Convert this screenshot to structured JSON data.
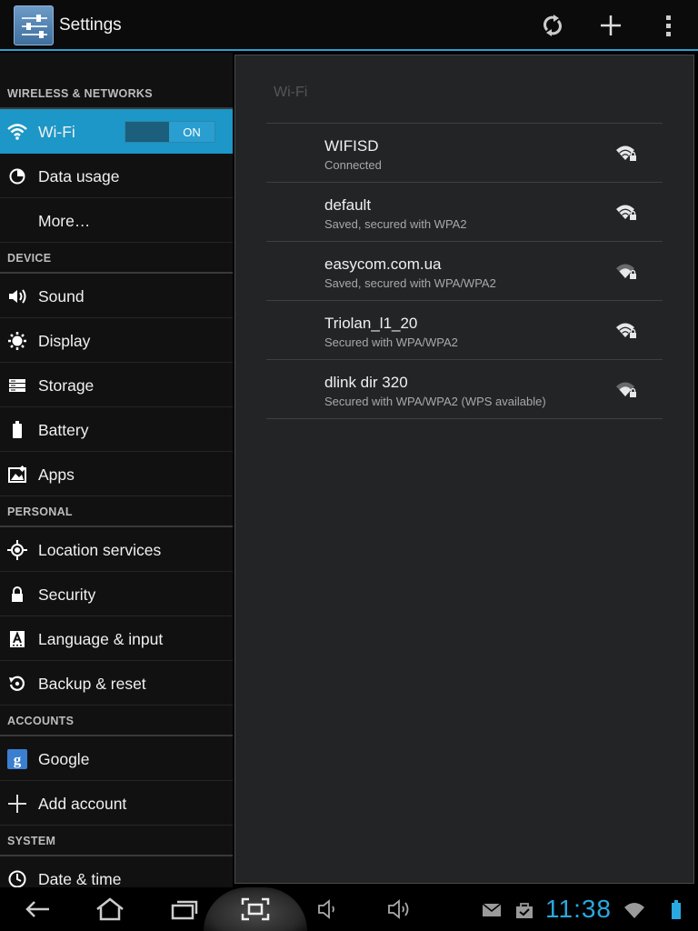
{
  "action_bar": {
    "title": "Settings",
    "actions": [
      {
        "name": "sync-icon"
      },
      {
        "name": "add-network-icon"
      },
      {
        "name": "overflow-menu-icon"
      }
    ]
  },
  "sidebar": {
    "sections": [
      {
        "header": "WIRELESS & NETWORKS",
        "items": [
          {
            "label": "Wi-Fi",
            "icon": "wifi-icon",
            "selected": true,
            "toggle": "ON"
          },
          {
            "label": "Data usage",
            "icon": "data-usage-icon"
          },
          {
            "label": "More…",
            "icon": ""
          }
        ]
      },
      {
        "header": "DEVICE",
        "items": [
          {
            "label": "Sound",
            "icon": "sound-icon"
          },
          {
            "label": "Display",
            "icon": "display-icon"
          },
          {
            "label": "Storage",
            "icon": "storage-icon"
          },
          {
            "label": "Battery",
            "icon": "battery-icon"
          },
          {
            "label": "Apps",
            "icon": "apps-icon"
          }
        ]
      },
      {
        "header": "PERSONAL",
        "items": [
          {
            "label": "Location services",
            "icon": "location-icon"
          },
          {
            "label": "Security",
            "icon": "lock-icon"
          },
          {
            "label": "Language & input",
            "icon": "language-icon"
          },
          {
            "label": "Backup & reset",
            "icon": "backup-icon"
          }
        ]
      },
      {
        "header": "ACCOUNTS",
        "items": [
          {
            "label": "Google",
            "icon": "google-icon"
          },
          {
            "label": "Add account",
            "icon": "add-icon"
          }
        ]
      },
      {
        "header": "SYSTEM",
        "items": [
          {
            "label": "Date & time",
            "icon": "clock-icon"
          }
        ]
      }
    ]
  },
  "wifi_pane": {
    "title": "Wi-Fi",
    "networks": [
      {
        "ssid": "WIFISD",
        "status": "Connected"
      },
      {
        "ssid": "default",
        "status": "Saved, secured with WPA2"
      },
      {
        "ssid": "easycom.com.ua",
        "status": "Saved, secured with WPA/WPA2"
      },
      {
        "ssid": "Triolan_l1_20",
        "status": "Secured with WPA/WPA2"
      },
      {
        "ssid": "dlink dir 320",
        "status": "Secured with WPA/WPA2 (WPS available)"
      }
    ]
  },
  "system_bar": {
    "clock": "11:38",
    "accent": "#2aa8e0"
  }
}
